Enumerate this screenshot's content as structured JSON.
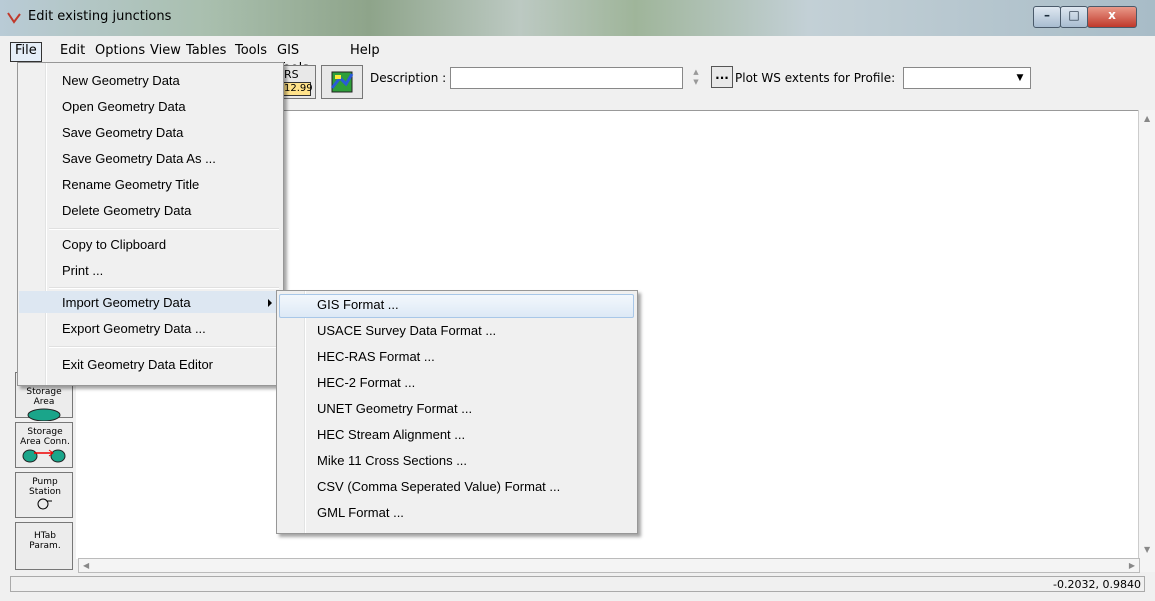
{
  "window": {
    "title": "Edit existing junctions",
    "minimize": "–",
    "maximize": "□",
    "close": "x"
  },
  "menubar": [
    "File",
    "Edit",
    "Options",
    "View",
    "Tables",
    "Tools",
    "GIS Tools",
    "Help"
  ],
  "file_menu": {
    "items": [
      "New Geometry Data",
      "Open Geometry Data",
      "Save Geometry Data",
      "Save Geometry Data As ...",
      "Rename Geometry Title",
      "Delete Geometry Data",
      "Copy to Clipboard",
      "Print ...",
      "Import Geometry Data",
      "Export Geometry Data ...",
      "Exit Geometry Data Editor"
    ]
  },
  "import_menu": {
    "items": [
      "GIS Format ...",
      "USACE Survey Data Format ...",
      "HEC-RAS Format ...",
      "HEC-2 Format ...",
      "UNET Geometry Format ...",
      "HEC Stream Alignment ...",
      "Mike 11 Cross Sections ...",
      "CSV (Comma Seperated Value) Format ...",
      "GML Format ..."
    ]
  },
  "toolbar": {
    "rs_label": "RS",
    "rs_value": "12.99",
    "description_label": "Description :",
    "description_value": "",
    "dots_label": "...",
    "plot_ws_label": "Plot WS extents for Profile:",
    "profile_value": ""
  },
  "left_tools": [
    {
      "label": "Storage Area",
      "icon": "storage-area-icon"
    },
    {
      "label": "Storage Area Conn.",
      "icon": "storage-area-connection-icon"
    },
    {
      "label": "Pump Station",
      "icon": "pump-icon"
    },
    {
      "label": "HTab Param.",
      "icon": ""
    }
  ],
  "status": {
    "coords": "-0.2032, 0.9840"
  },
  "colors": {
    "menu_highlight": "#dde7f2",
    "rs_tag": "#ffe28a",
    "storage_area": "#1aa58a"
  }
}
